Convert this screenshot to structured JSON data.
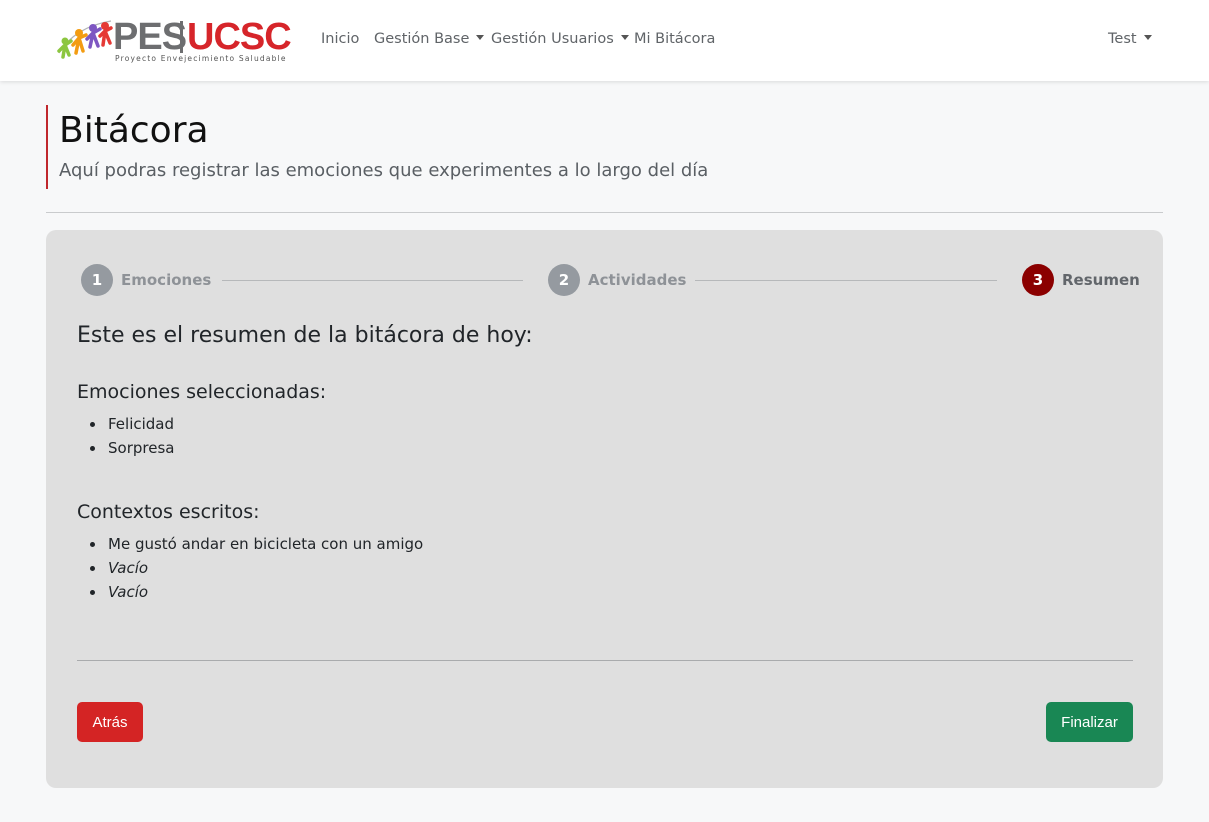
{
  "brand": {
    "logo_main": "PES",
    "logo_secondary": "UCSC",
    "logo_tagline": "Proyecto Envejecimiento Saludable"
  },
  "nav": {
    "items": [
      {
        "label": "Inicio",
        "dropdown": false
      },
      {
        "label": "Gestión Base",
        "dropdown": true
      },
      {
        "label": "Gestión Usuarios",
        "dropdown": true
      },
      {
        "label": "Mi Bitácora",
        "dropdown": false
      }
    ],
    "user": {
      "label": "Test",
      "dropdown": true
    }
  },
  "header": {
    "title": "Bitácora",
    "subtitle": "Aquí podras registrar las emociones que experimentes a lo largo del día"
  },
  "stepper": {
    "steps": [
      {
        "number": "1",
        "label": "Emociones",
        "active": false
      },
      {
        "number": "2",
        "label": "Actividades",
        "active": false
      },
      {
        "number": "3",
        "label": "Resumen",
        "active": true
      }
    ]
  },
  "summary": {
    "title": "Este es el resumen de la bitácora de hoy:",
    "emotions_heading": "Emociones seleccionadas:",
    "emotions": [
      "Felicidad",
      "Sorpresa"
    ],
    "contexts_heading": "Contextos escritos:",
    "contexts": [
      {
        "text": "Me gustó andar en bicicleta con un amigo",
        "empty": false
      },
      {
        "text": "Vacío",
        "empty": true
      },
      {
        "text": "Vacío",
        "empty": true
      }
    ]
  },
  "buttons": {
    "back_label": "Atrás",
    "finish_label": "Finalizar"
  },
  "colors": {
    "accent_red": "#c0272d",
    "step_active": "#8b0000",
    "btn_back": "#d42424",
    "btn_finish": "#198754"
  }
}
